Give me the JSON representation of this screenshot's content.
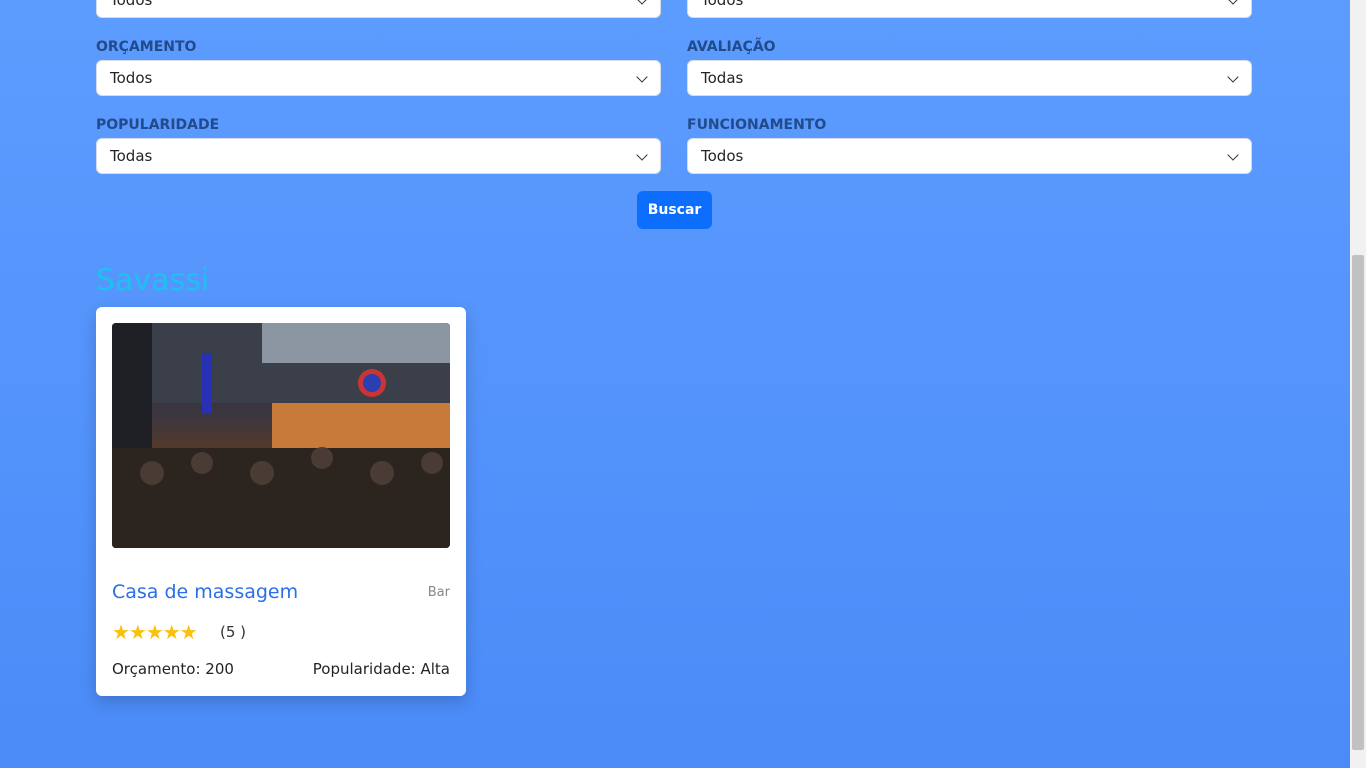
{
  "filters": [
    {
      "label": "",
      "value": "Todos"
    },
    {
      "label": "",
      "value": "Todos"
    },
    {
      "label": "ORÇAMENTO",
      "value": "Todos"
    },
    {
      "label": "AVALIAÇÃO",
      "value": "Todas"
    },
    {
      "label": "POPULARIDADE",
      "value": "Todas"
    },
    {
      "label": "FUNCIONAMENTO",
      "value": "Todos"
    }
  ],
  "search_button": "Buscar",
  "section_title": "Savassi",
  "card": {
    "name": "Casa de massagem",
    "type": "Bar",
    "stars": "★★★★★",
    "rating_count": "(5 )",
    "budget": "Orçamento: 200",
    "popularity": "Popularidade: Alta"
  }
}
